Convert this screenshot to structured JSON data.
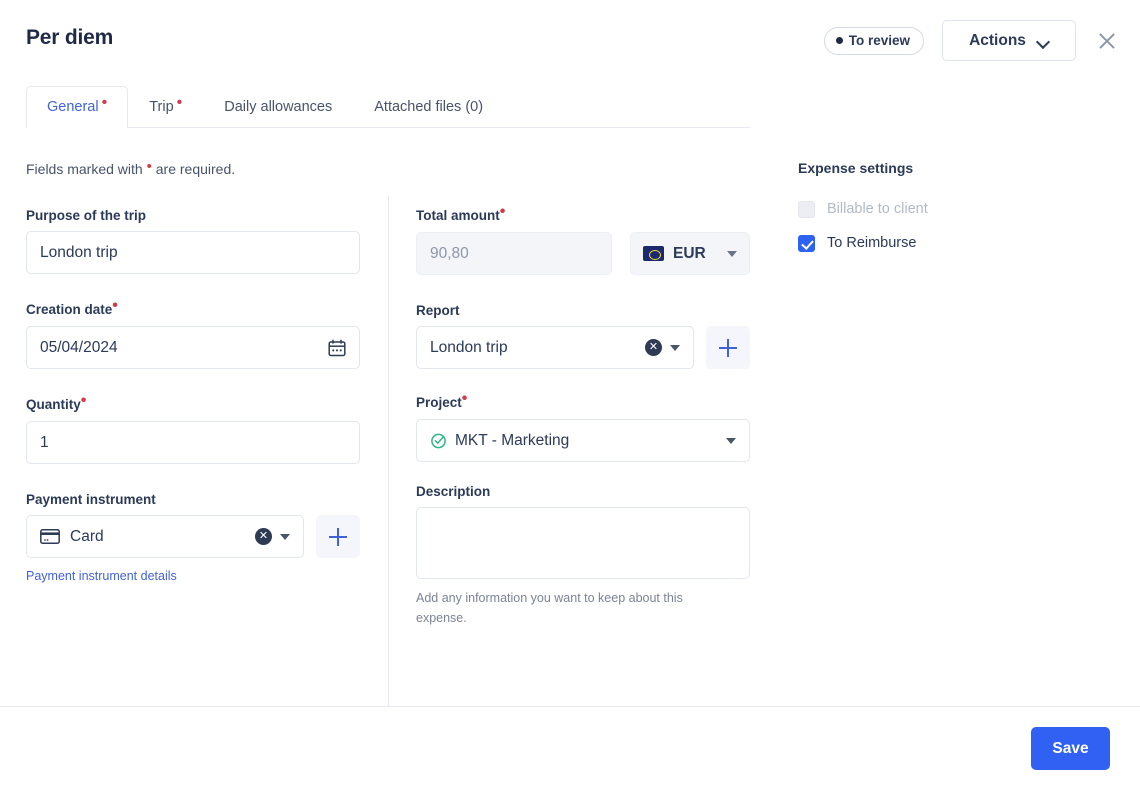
{
  "header": {
    "title": "Per diem",
    "status_badge": "To review",
    "actions_label": "Actions",
    "close_icon": "close-icon"
  },
  "tabs": [
    {
      "label": "General",
      "required": true,
      "active": true
    },
    {
      "label": "Trip",
      "required": true,
      "active": false
    },
    {
      "label": "Daily allowances",
      "required": false,
      "active": false
    },
    {
      "label": "Attached files (0)",
      "required": false,
      "active": false
    }
  ],
  "form": {
    "required_note_before": "Fields marked with",
    "required_note_after": "are required.",
    "purpose": {
      "label": "Purpose of the trip",
      "value": "London trip"
    },
    "creation_date": {
      "label": "Creation date",
      "value": "05/04/2024",
      "icon": "calendar-icon",
      "required": true
    },
    "quantity": {
      "label": "Quantity",
      "value": "1",
      "required": true
    },
    "payment_instrument": {
      "label": "Payment instrument",
      "value": "Card",
      "icon": "credit-card-icon",
      "details_link": "Payment instrument details"
    },
    "total_amount": {
      "label": "Total amount",
      "value": "90,80",
      "required": true,
      "disabled": true
    },
    "currency": {
      "value": "EUR",
      "flag": "eu-flag-icon"
    },
    "report": {
      "label": "Report",
      "value": "London trip"
    },
    "project": {
      "label": "Project",
      "value": "MKT - Marketing",
      "icon": "check-circle-icon",
      "required": true
    },
    "description": {
      "label": "Description",
      "value": "",
      "helper": "Add any information you want to keep about this expense."
    },
    "add_button_label": "+"
  },
  "expense_settings": {
    "title": "Expense settings",
    "options": [
      {
        "label": "Billable to client",
        "checked": false,
        "disabled": true
      },
      {
        "label": "To Reimburse",
        "checked": true,
        "disabled": false
      }
    ]
  },
  "footer": {
    "save_label": "Save"
  },
  "colors": {
    "accent": "#3061f2",
    "tab_active": "#4263d8",
    "required": "#d43b4a",
    "link": "#4263d8",
    "text": "#2b3a57",
    "muted": "#8d97a9",
    "border": "#e2e6ed",
    "disabled_bg": "#f3f5f9",
    "project_check": "#32b687"
  }
}
